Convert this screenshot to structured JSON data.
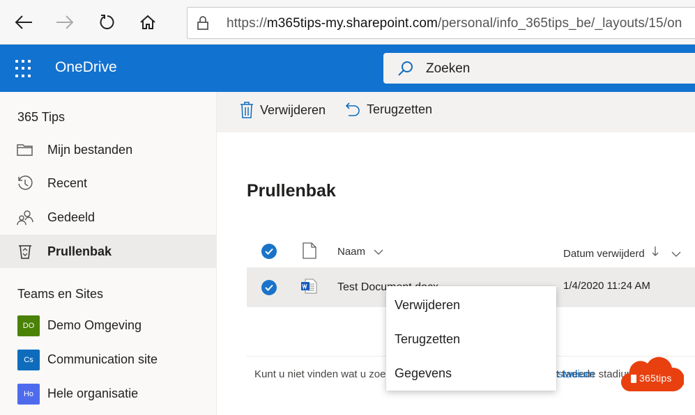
{
  "browser": {
    "url_host": "m365tips-my.sharepoint.com",
    "url_scheme": "https://",
    "url_path": "/personal/info_365tips_be/_layouts/15/on"
  },
  "suite": {
    "app_name": "OneDrive",
    "search_placeholder": "Zoeken",
    "brand_color": "#1272d0"
  },
  "leftnav": {
    "user_heading": "365 Tips",
    "items": [
      {
        "label": "Mijn bestanden",
        "icon": "folder-icon"
      },
      {
        "label": "Recent",
        "icon": "history-icon"
      },
      {
        "label": "Gedeeld",
        "icon": "people-icon"
      },
      {
        "label": "Prullenbak",
        "icon": "recycle-bin-icon",
        "active": true
      }
    ],
    "sites_heading": "Teams en Sites",
    "sites": [
      {
        "initials": "DO",
        "label": "Demo Omgeving",
        "color": "#498205"
      },
      {
        "initials": "Cs",
        "label": "Communication site",
        "color": "#0f6cbd"
      },
      {
        "initials": "Ho",
        "label": "Hele organisatie",
        "color": "#4f6bed"
      }
    ]
  },
  "commandbar": {
    "delete_label": "Verwijderen",
    "restore_label": "Terugzetten"
  },
  "main": {
    "title": "Prullenbak",
    "columns": {
      "name": "Naam",
      "date_deleted": "Datum verwijderd"
    },
    "rows": [
      {
        "name": "Test Document.docx",
        "date_deleted": "1/4/2020 11:24 AM",
        "selected": true
      }
    ],
    "footer_text": "Kunt u niet vinden wat u zoekt? Controleer de Prullenbak voor het tweede stadium",
    "footer_link": "stadium"
  },
  "context_menu": {
    "items": [
      "Verwijderen",
      "Terugzetten",
      "Gegevens"
    ]
  },
  "watermark": {
    "text": "365tips"
  }
}
